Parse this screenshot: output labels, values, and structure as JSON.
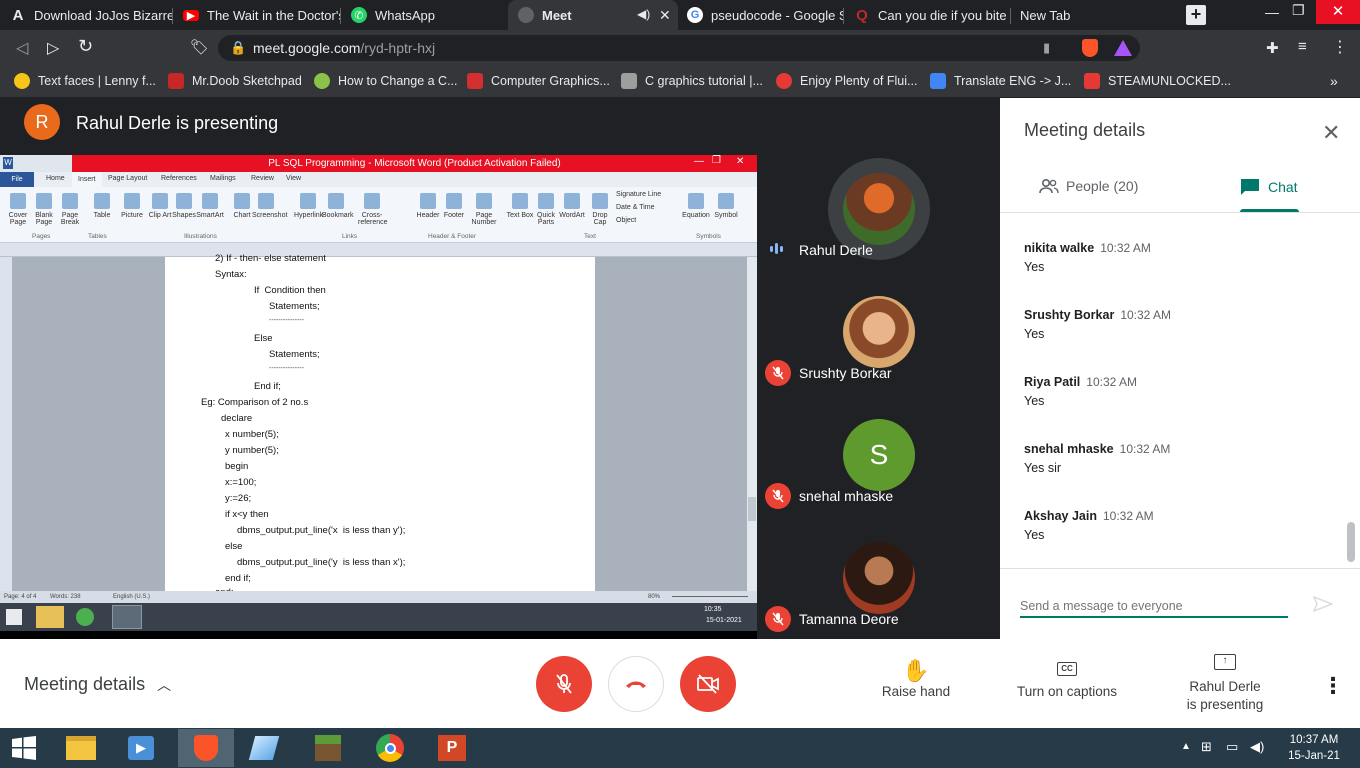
{
  "browser": {
    "tabs": [
      {
        "title": "Download JoJos Bizarre A",
        "icon": "a-icon",
        "color": "#e8eaed"
      },
      {
        "title": "The Wait in the Doctor's",
        "icon": "youtube-icon",
        "color": "#ff0000"
      },
      {
        "title": "WhatsApp",
        "icon": "whatsapp-icon",
        "color": "#25d366"
      },
      {
        "title": "Meet",
        "icon": "meet-icon",
        "color": "#9aa0a6"
      },
      {
        "title": "pseudocode - Google Se",
        "icon": "google-icon",
        "color": "#4285f4"
      },
      {
        "title": "Can you die if you bite th",
        "icon": "quora-icon",
        "color": "#b92b27"
      },
      {
        "title": "New Tab",
        "icon": "",
        "color": ""
      }
    ],
    "url_domain": "meet.google.com",
    "url_path": "/ryd-hptr-hxj",
    "bookmarks": [
      {
        "label": "Text faces | Lenny f...",
        "color": "#f5c518"
      },
      {
        "label": "Mr.Doob Sketchpad",
        "color": "#c62828"
      },
      {
        "label": "How to Change a C...",
        "color": "#8bc34a"
      },
      {
        "label": "Computer Graphics...",
        "color": "#d32f2f"
      },
      {
        "label": "C graphics tutorial |...",
        "color": "#9e9e9e"
      },
      {
        "label": "Enjoy Plenty of Flui...",
        "color": "#e53935"
      },
      {
        "label": "Translate ENG -> J...",
        "color": "#4285f4"
      },
      {
        "label": "STEAMUNLOCKED...",
        "color": "#e53935"
      }
    ],
    "bookmarks_more": "»"
  },
  "meet": {
    "presenter_initial": "R",
    "presenting_title": "Rahul Derle is presenting",
    "participants": [
      {
        "name": "Rahul Derle",
        "status": "speaking",
        "avatar_color": "#7a3b20"
      },
      {
        "name": "Srushty Borkar",
        "status": "muted",
        "avatar_color": "#c9925e"
      },
      {
        "name": "snehal mhaske",
        "status": "muted",
        "avatar_color": "#5f9a2f",
        "initial": "S"
      },
      {
        "name": "Tamanna Deore",
        "status": "muted",
        "avatar_color": "#4a2a1e"
      }
    ],
    "panel": {
      "title": "Meeting details",
      "tab_people": "People (20)",
      "tab_chat": "Chat",
      "messages": [
        {
          "name": "nikita walke",
          "time": "10:32 AM",
          "text": "Yes"
        },
        {
          "name": "Srushty Borkar",
          "time": "10:32 AM",
          "text": "Yes"
        },
        {
          "name": "Riya Patil",
          "time": "10:32 AM",
          "text": "Yes"
        },
        {
          "name": "snehal mhaske",
          "time": "10:32 AM",
          "text": "Yes sir"
        },
        {
          "name": "Akshay Jain",
          "time": "10:32 AM",
          "text": "Yes"
        }
      ],
      "input_placeholder": "Send a message to everyone"
    },
    "bottom": {
      "meeting_details": "Meeting details",
      "raise_hand": "Raise hand",
      "captions": "Turn on captions",
      "presenting_line1": "Rahul Derle",
      "presenting_line2": "is presenting"
    }
  },
  "word": {
    "title": "PL SQL Programming - Microsoft Word (Product Activation Failed)",
    "tabs": [
      "File",
      "Home",
      "Insert",
      "Page Layout",
      "References",
      "Mailings",
      "Review",
      "View"
    ],
    "ribbon_buttons": [
      "Cover Page",
      "Blank Page",
      "Page Break",
      "Table",
      "Picture",
      "Clip Art",
      "Shapes",
      "SmartArt",
      "Chart",
      "Screenshot",
      "Hyperlink",
      "Bookmark",
      "Cross-reference",
      "Header",
      "Footer",
      "Page Number",
      "Text Box",
      "Quick Parts",
      "WordArt",
      "Drop Cap",
      "Equation",
      "Symbol"
    ],
    "ribbon_small": [
      "Signature Line",
      "Date & Time",
      "Object"
    ],
    "groups": [
      "Pages",
      "Tables",
      "Illustrations",
      "Links",
      "Header & Footer",
      "Text",
      "Symbols"
    ],
    "document_lines": [
      "2) If - then- else statement",
      "Syntax:",
      "If  Condition then",
      "Statements;",
      "---------------",
      "Else",
      "Statements;",
      "---------------",
      "End if;",
      "Eg: Comparison of 2 no.s",
      "declare",
      "x number(5);",
      "y number(5);",
      "begin",
      "x:=100;",
      "y:=26;",
      "if x<y then",
      "dbms_output.put_line('x  is less than y');",
      "else",
      "dbms_output.put_line('y  is less than x');",
      "end if;",
      "end;"
    ],
    "status_page": "Page: 4 of 4",
    "status_words": "Words: 238",
    "status_lang": "English (U.S.)",
    "zoom": "80%",
    "inner_time": "10:35",
    "inner_date": "15-01-2021"
  },
  "taskbar": {
    "time": "10:37 AM",
    "date": "15-Jan-21"
  }
}
